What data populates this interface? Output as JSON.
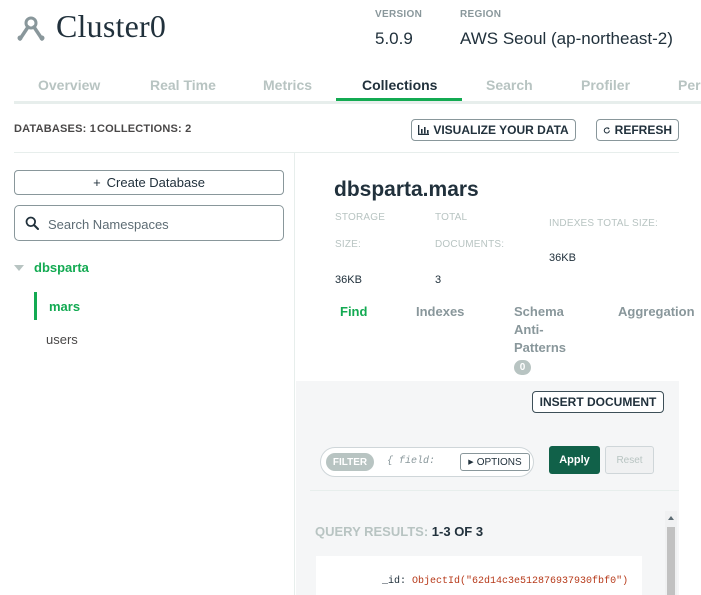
{
  "header": {
    "cluster_name": "Cluster0",
    "version_label": "VERSION",
    "version_value": "5.0.9",
    "region_label": "REGION",
    "region_value": "AWS Seoul (ap-northeast-2)"
  },
  "tabs": [
    {
      "label": "Overview"
    },
    {
      "label": "Real Time"
    },
    {
      "label": "Metrics"
    },
    {
      "label": "Collections",
      "active": true
    },
    {
      "label": "Search"
    },
    {
      "label": "Profiler"
    },
    {
      "label": "Per"
    }
  ],
  "infobar": {
    "databases_label": "DATABASES:",
    "databases_count": "1",
    "collections_label": "COLLECTIONS:",
    "collections_count": "2",
    "visualize_label": "VISUALIZE YOUR DATA",
    "refresh_label": "REFRESH"
  },
  "sidebar": {
    "create_db_label": "Create Database",
    "search_placeholder": "Search Namespaces",
    "database": "dbsparta",
    "collections": [
      "mars",
      "users"
    ]
  },
  "namespace": {
    "title": "dbsparta.mars",
    "storage_label_1": "STORAGE",
    "storage_label_2": "SIZE:",
    "storage_value": "36KB",
    "docs_label_1": "TOTAL",
    "docs_label_2": "DOCUMENTS:",
    "docs_value": "3",
    "indexes_label": "INDEXES TOTAL SIZE:",
    "indexes_value": "36KB"
  },
  "subtabs": {
    "find": "Find",
    "indexes": "Indexes",
    "schema_1": "Schema",
    "schema_2": "Anti-",
    "schema_3": "Patterns",
    "schema_badge": "0",
    "aggregation": "Aggregation"
  },
  "query": {
    "insert_label": "INSERT DOCUMENT",
    "filter_label": "FILTER",
    "filter_placeholder": "{ field:",
    "options_label": "OPTIONS",
    "apply_label": "Apply",
    "reset_label": "Reset",
    "results_label": "QUERY RESULTS:",
    "results_count": "1-3 OF 3",
    "doc_key": "_id:",
    "doc_value": "ObjectId(\"62d14c3e512876937930fbf0\")"
  },
  "colors": {
    "accent_green": "#13aa52",
    "apply_green": "#116149"
  }
}
